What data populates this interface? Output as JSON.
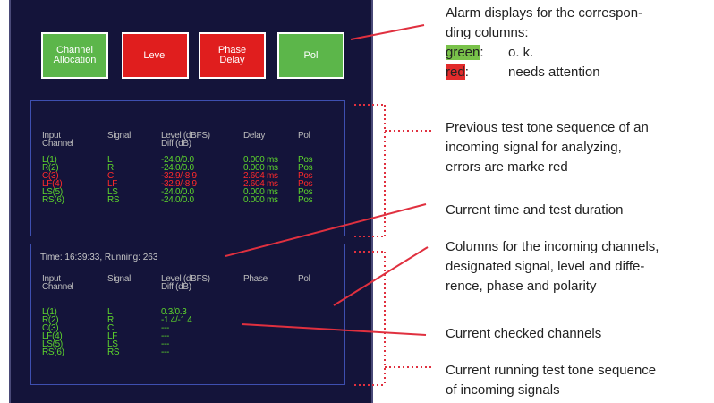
{
  "alarms": [
    {
      "label": "Channel\nAllocation",
      "status": "green",
      "color": "#5cb64a"
    },
    {
      "label": "Level",
      "status": "red",
      "color": "#e01e1e"
    },
    {
      "label": "Phase\nDelay",
      "status": "red",
      "color": "#e01e1e"
    },
    {
      "label": "Pol",
      "status": "green",
      "color": "#5cb64a"
    }
  ],
  "previous": {
    "headers": {
      "input": "Input\nChannel",
      "signal": "Signal",
      "level": "Level (dBFS)\nDiff (dB)",
      "delay": "Delay",
      "pol": "Pol"
    },
    "rows": [
      {
        "channel": "L(1)",
        "signal": "L",
        "level": "-24.0/0.0",
        "delay": "0.000 ms",
        "pol": "Pos",
        "status": "ok"
      },
      {
        "channel": "R(2)",
        "signal": "R",
        "level": "-24.0/0.0",
        "delay": "0.000 ms",
        "pol": "Pos",
        "status": "ok"
      },
      {
        "channel": "C(3)",
        "signal": "C",
        "level": "-32.9/-8.9",
        "delay": "2.604 ms",
        "pol": "Pos",
        "status": "error"
      },
      {
        "channel": "LF(4)",
        "signal": "LF",
        "level": "-32.9/-8.9",
        "delay": "2.604 ms",
        "pol": "Pos",
        "status": "error"
      },
      {
        "channel": "LS(5)",
        "signal": "LS",
        "level": "-24.0/0.0",
        "delay": "0.000 ms",
        "pol": "Pos",
        "status": "ok"
      },
      {
        "channel": "RS(6)",
        "signal": "RS",
        "level": "-24.0/0.0",
        "delay": "0.000 ms",
        "pol": "Pos",
        "status": "ok"
      }
    ]
  },
  "current": {
    "time_text": "Time: 16:39:33, Running: 263",
    "headers": {
      "input": "Input\nChannel",
      "signal": "Signal",
      "level": "Level (dBFS)\nDiff (dB)",
      "phase": "Phase",
      "pol": "Pol"
    },
    "rows": [
      {
        "channel": "L(1)",
        "signal": "L",
        "level": "0.3/0.3"
      },
      {
        "channel": "R(2)",
        "signal": "R",
        "level": "-1.4/-1.4"
      },
      {
        "channel": "C(3)",
        "signal": "C",
        "level": "---"
      },
      {
        "channel": "LF(4)",
        "signal": "LF",
        "level": "---"
      },
      {
        "channel": "LS(5)",
        "signal": "LS",
        "level": "---"
      },
      {
        "channel": "RS(6)",
        "signal": "RS",
        "level": "---"
      }
    ]
  },
  "annotations": {
    "alarm_intro": "Alarm displays for the corresponding columns:",
    "alarm_l1": "Alarm displays for the correspon-",
    "alarm_l2": "ding columns:",
    "green_key": "green",
    "green_text": "o. k.",
    "red_key": "red",
    "red_text": "needs attention",
    "previous_l1": "Previous test tone sequence of an",
    "previous_l2": "incoming signal for analyzing,",
    "previous_l3": "errors are marke red",
    "time": "Current time and test duration",
    "columns_l1": "Columns for the incoming channels,",
    "columns_l2": "designated signal, level and diffe-",
    "columns_l3": "rence, phase and polarity",
    "checked": "Current checked channels",
    "running_l1": "Current running test tone sequence",
    "running_l2": "of incoming signals"
  },
  "colors": {
    "screen_bg": "#14143a",
    "ok": "#5dd52c",
    "error": "#ff2a2a",
    "leader": "#e0303f"
  }
}
